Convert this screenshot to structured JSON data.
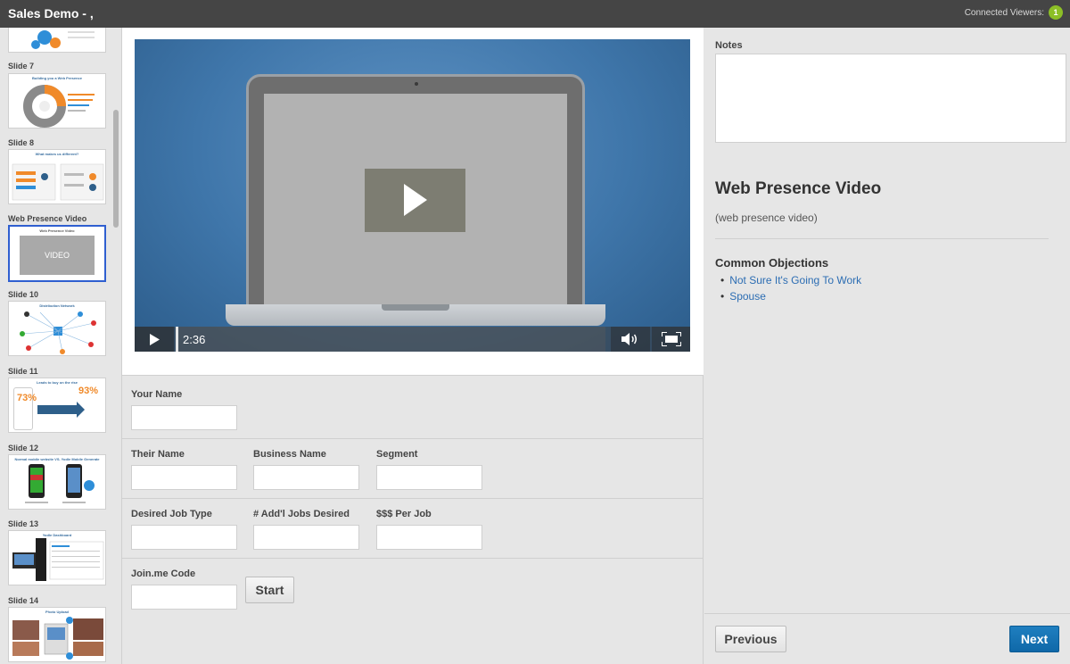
{
  "app": {
    "title": "Sales Demo - ,",
    "connected_viewers_label": "Connected Viewers:",
    "connected_viewers_count": "1"
  },
  "sidebar": {
    "slides": [
      {
        "label": "Slide 7",
        "thumb_title": "Building you a Web Presence"
      },
      {
        "label": "Slide 8",
        "thumb_title": "What makes us different?"
      },
      {
        "label": "Web Presence Video",
        "thumb_title": "Web Presence Video",
        "thumb_text": "VIDEO",
        "active": true
      },
      {
        "label": "Slide 10",
        "thumb_title": "Distribution Network"
      },
      {
        "label": "Slide 11",
        "thumb_title": "Leads to buy on the rise",
        "stat_a": "73%",
        "stat_b": "93%"
      },
      {
        "label": "Slide 12",
        "thumb_title": "Normal mobile website VS. Yodle Mobile Generate"
      },
      {
        "label": "Slide 13",
        "thumb_title": "Yodle Dashboard"
      },
      {
        "label": "Slide 14",
        "thumb_title": "Photo Upload"
      }
    ]
  },
  "video": {
    "time": "2:36",
    "progress": 0.0
  },
  "form": {
    "your_name": {
      "label": "Your Name",
      "value": ""
    },
    "their_name": {
      "label": "Their Name",
      "value": ""
    },
    "business_name": {
      "label": "Business Name",
      "value": ""
    },
    "segment": {
      "label": "Segment",
      "value": ""
    },
    "desired_job_type": {
      "label": "Desired Job Type",
      "value": ""
    },
    "addl_jobs": {
      "label": "# Add'l Jobs Desired",
      "value": ""
    },
    "per_job": {
      "label": "$$$ Per Job",
      "value": ""
    },
    "joinme_code": {
      "label": "Join.me Code",
      "value": ""
    },
    "start_label": "Start"
  },
  "right": {
    "notes_label": "Notes",
    "notes_value": "",
    "slide_title": "Web Presence Video",
    "slide_desc": "(web presence video)",
    "objections_title": "Common Objections",
    "objections": [
      "Not Sure It's Going To Work",
      "Spouse"
    ],
    "previous_label": "Previous",
    "next_label": "Next"
  },
  "colors": {
    "topbar": "#454545",
    "accent_blue": "#1273b5",
    "viewer_badge": "#8cbf26",
    "active_thumb_border": "#2f5fd0",
    "link": "#2c6db3"
  }
}
